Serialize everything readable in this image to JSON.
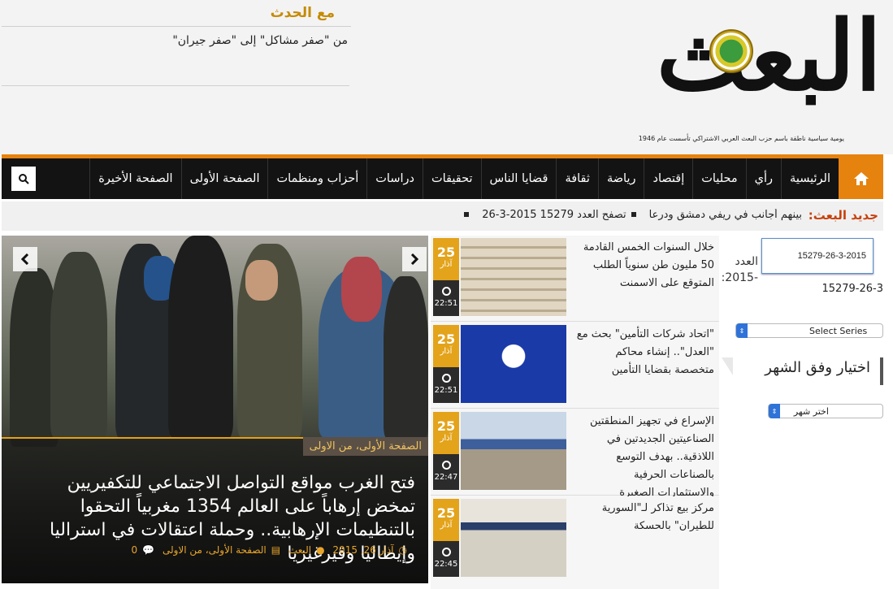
{
  "header": {
    "masthead": "البعث",
    "tagline": "يومية سياسية ناطقة باسم حزب البعث العربي الاشتراكي تأسست عام 1946",
    "event_title": "مع الحدث",
    "event_item": "من \"صفر مشاكل\" إلى \"صفر جيران\""
  },
  "nav": {
    "items": [
      "الرئيسية",
      "رأي",
      "محليات",
      "إقتصاد",
      "رياضة",
      "ثقافة",
      "قضايا الناس",
      "تحقيقات",
      "دراسات",
      "أحزاب ومنظمات",
      "الصفحة الأولى",
      "الصفحة الأخيرة"
    ],
    "home_icon": "home-icon",
    "search_icon": "search-icon",
    "accent": "#e6820e"
  },
  "ticker": {
    "label": "جديد البعث:",
    "items": [
      "بينهم أجانب في ريفي دمشق ودرعا",
      "تصفح العدد 15279 2015-3-26"
    ]
  },
  "slider": {
    "category": "الصفحة الأولى، من الاولى",
    "headline": "فتح الغرب مواقع التواصل الاجتماعي للتكفيريين تمخض إرهاباً على العالم 1354 مغربياً التحقوا بالتنظيمات الإرهابية.. وحملة اعتقالات في استراليا وإيطاليا وقيرغيزيا",
    "date": "آذار 26, 2015",
    "author": "البعث",
    "categories": "الصفحة الأولى، من الاولى",
    "comments": "0"
  },
  "news": [
    {
      "day": "25",
      "month": "آذار",
      "time": "22:51",
      "title": "خلال السنوات الخمس القادمة 50 مليون طن سنوياً الطلب المتوقع على الاسمنت"
    },
    {
      "day": "25",
      "month": "آذار",
      "time": "22:51",
      "title": "\"اتحاد شركات التأمين\" بحث مع \"العدل\".. إنشاء محاكم متخصصة بقضايا التأمين"
    },
    {
      "day": "25",
      "month": "آذار",
      "time": "22:47",
      "title": "الإسراع في تجهيز المنطقتين الصناعيتين الجديدتين في اللاذقية.. بهدف التوسع بالصناعات الحرفية والاستثمارات الصغيرة"
    },
    {
      "day": "25",
      "month": "آذار",
      "time": "22:45",
      "title": "مركز بيع تذاكر لـ\"السورية للطيران\" بالحسكة"
    }
  ],
  "sidebar": {
    "issue_label": "العدد -2015:",
    "issue_input": "15279-26-3-2015",
    "issue_value": "15279-26-3",
    "series_select": "Select Series",
    "month_title": "اختيار وفق الشهر",
    "month_select": "اختر شهر"
  }
}
